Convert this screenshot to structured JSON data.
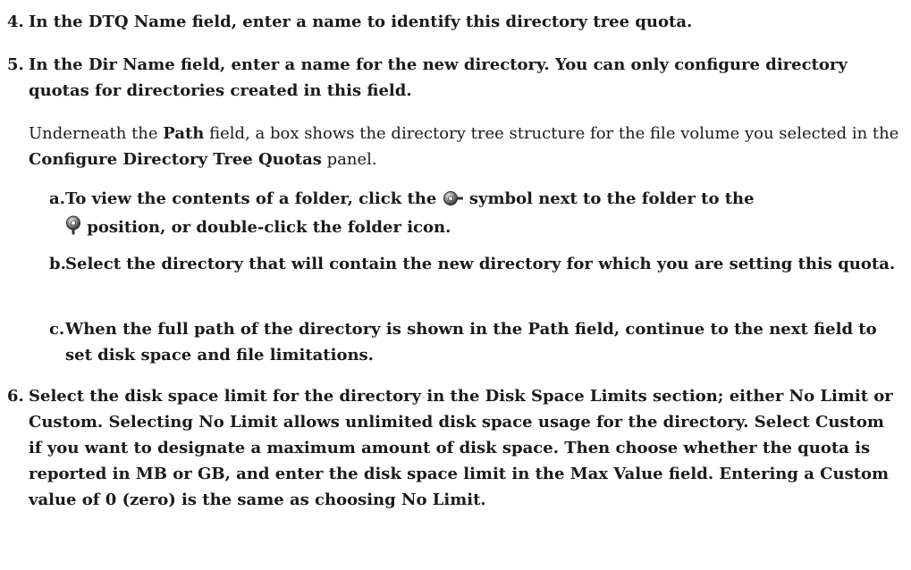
{
  "steps": {
    "s4": {
      "num": "4.",
      "text": "In the DTQ Name field, enter a name to identify this directory tree quota."
    },
    "s5": {
      "num": "5.",
      "text": "In the Dir Name field, enter a name for the new directory. You can only configure directory quotas for directories created in this field."
    },
    "s6": {
      "num": "6.",
      "text": "Select the disk space limit for the directory in the Disk Space Limits section; either No Limit or Custom. Selecting No Limit allows unlimited disk space usage for the directory. Select Custom if you want to designate a maximum amount of disk space. Then choose whether the quota is reported in MB or GB, and enter the disk space limit in the Max Value field. Entering a Custom value of 0 (zero) is the same as choosing No Limit."
    }
  },
  "note": {
    "t1": "Underneath the ",
    "b1": "Path",
    "t2": " field, a box shows the directory tree structure for the file volume you selected in the ",
    "b2": "Configure Directory Tree Quotas",
    "t3": " panel."
  },
  "substeps": {
    "a": {
      "num": "a.",
      "t1": "To view the contents of a folder, click the ",
      "t2": " symbol next to the folder to the",
      "t3": " position, or double-click the folder icon.",
      "icon_collapsed": "collapsed-node-icon",
      "icon_expanded": "expanded-node-icon"
    },
    "b": {
      "num": "b.",
      "text": "Select the directory that will contain the new directory for which you are setting this quota."
    },
    "c": {
      "num": "c.",
      "text": "When the full path of the directory is shown in the Path field, continue to the next field to set disk space and file limitations."
    }
  }
}
